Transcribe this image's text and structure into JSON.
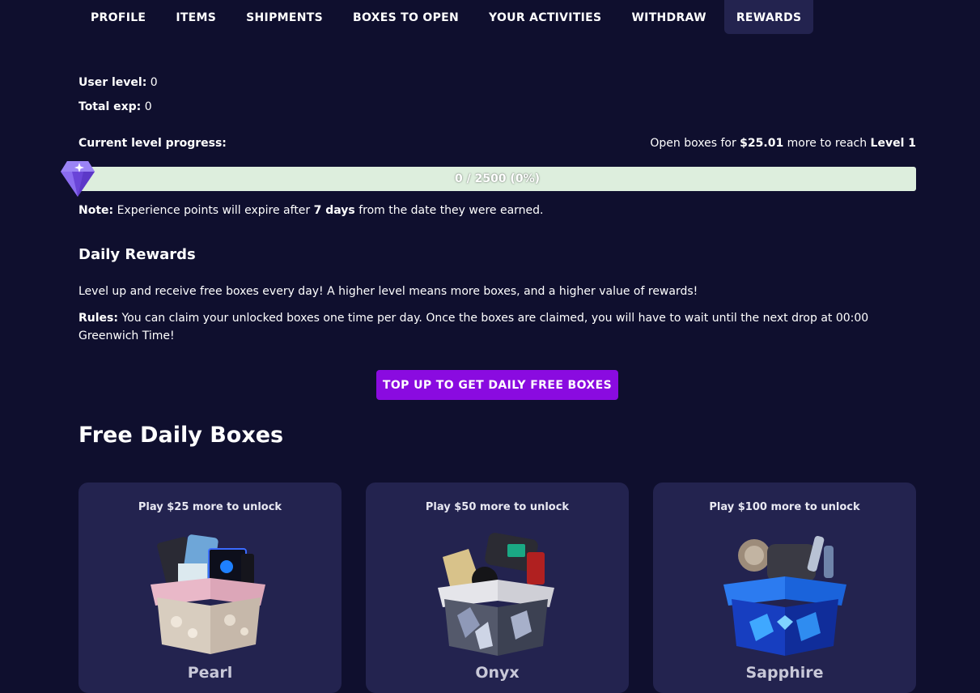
{
  "nav": {
    "tabs": [
      {
        "label": "PROFILE"
      },
      {
        "label": "ITEMS"
      },
      {
        "label": "SHIPMENTS"
      },
      {
        "label": "BOXES TO OPEN"
      },
      {
        "label": "YOUR ACTIVITIES"
      },
      {
        "label": "WITHDRAW"
      },
      {
        "label": "REWARDS"
      }
    ],
    "active": "REWARDS"
  },
  "stats": {
    "user_level_label": "User level:",
    "user_level": "0",
    "total_exp_label": "Total exp:",
    "total_exp": "0"
  },
  "progress": {
    "label": "Current level progress:",
    "open_prefix": "Open boxes for",
    "amount": "$25.01",
    "middle": "more to reach",
    "target_level": "Level 1",
    "text": "0 / 2500 (0%)",
    "fraction": 0
  },
  "note": {
    "label": "Note:",
    "text_a": "Experience points will expire after",
    "days": "7 days",
    "text_b": "from the date they were earned."
  },
  "daily": {
    "heading": "Daily Rewards",
    "description": "Level up and receive free boxes every day! A higher level means more boxes, and a higher value of rewards!",
    "rules_label": "Rules:",
    "rules_text": "You can claim your unlocked boxes one time per day. Once the boxes are claimed, you will have to wait until the next drop at 00:00 Greenwich Time!"
  },
  "topup_button": "TOP UP TO GET DAILY FREE BOXES",
  "free_boxes": {
    "heading": "Free Daily Boxes",
    "cards": [
      {
        "unlock": "Play $25 more to unlock",
        "name": "Pearl",
        "icon": "pearl-box-icon"
      },
      {
        "unlock": "Play $50 more to unlock",
        "name": "Onyx",
        "icon": "onyx-box-icon"
      },
      {
        "unlock": "Play $100 more to unlock",
        "name": "Sapphire",
        "icon": "sapphire-box-icon"
      }
    ]
  },
  "colors": {
    "background": "#0f0f2e",
    "card": "#23234f",
    "accent": "#8a0be0",
    "progress_track": "#ddeedd",
    "gem": "#8e6bf0"
  }
}
